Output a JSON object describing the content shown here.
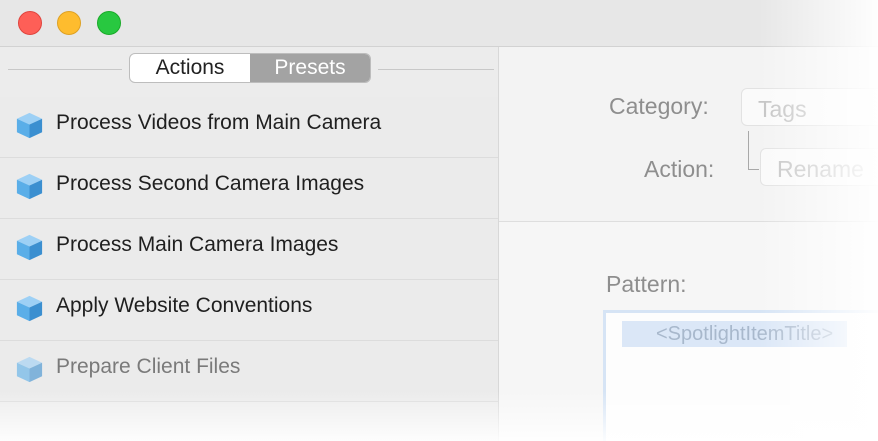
{
  "sidebar": {
    "segments": [
      {
        "label": "Actions",
        "active": false
      },
      {
        "label": "Presets",
        "active": true
      }
    ],
    "presets": [
      {
        "label": "Process Videos from Main Camera",
        "icon": "cube-icon"
      },
      {
        "label": "Process Second Camera Images",
        "icon": "cube-icon"
      },
      {
        "label": "Process Main Camera Images",
        "icon": "cube-icon"
      },
      {
        "label": "Apply Website Conventions",
        "icon": "cube-icon"
      },
      {
        "label": "Prepare Client Files",
        "icon": "cube-icon"
      }
    ]
  },
  "detail": {
    "category_label": "Category:",
    "category_value": "Tags",
    "action_label": "Action:",
    "action_value": "Rename",
    "pattern_label": "Pattern:",
    "pattern_token": "<SpotlightItemTitle>"
  },
  "colors": {
    "segment_active": "#a3a3a3",
    "cube_light": "#9dd0f5",
    "cube_mid": "#5aaee8",
    "cube_dark": "#3b8fd0",
    "close": "#fe5f57",
    "minimize": "#febc2e",
    "maximize": "#28c840"
  }
}
